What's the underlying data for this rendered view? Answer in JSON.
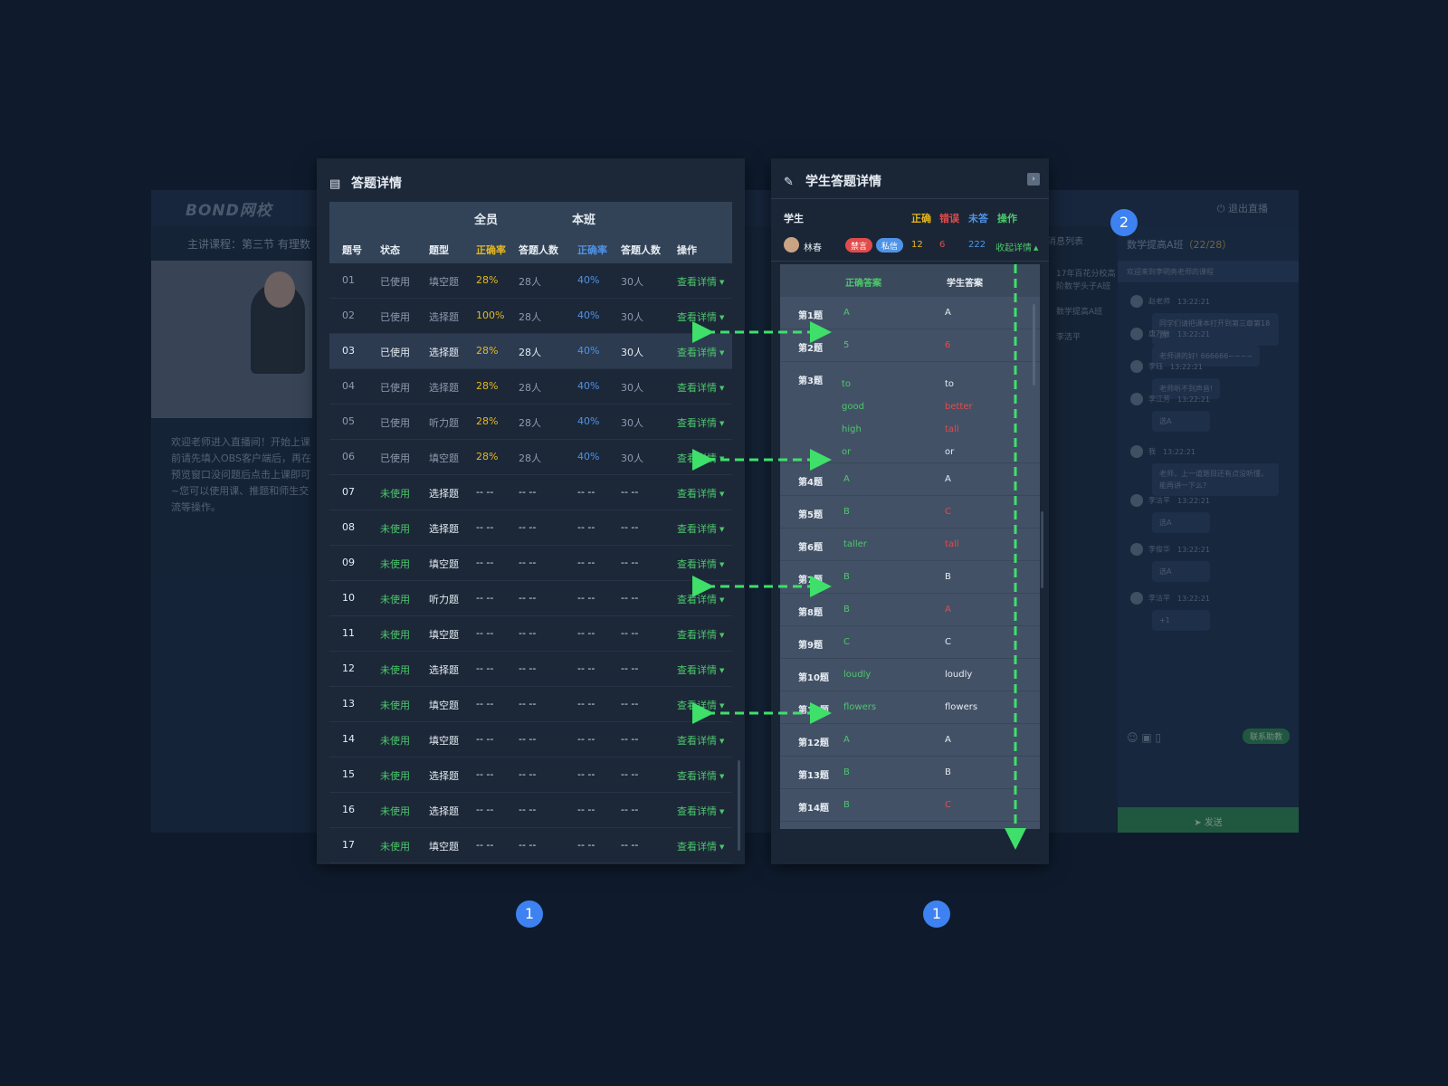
{
  "background": {
    "logo": "BOND网校",
    "exit_label": "退出直播",
    "course_label": "主讲课程：第三节 有理数",
    "welcome_text": "欢迎老师进入直播间！开始上课前请先填入OBS客户端后，再在预览窗口没问题后点击上课即可~您可以使用课、推题和师生交流等操作。",
    "message_list_label": "消息列表",
    "side_items": [
      "17年百花分校高阶数学头子A班",
      "数学提高A班",
      "李洁平"
    ],
    "chat_title": "数学提高A班",
    "chat_count": "（22/28）",
    "chat_welcome": "欢迎来到李明亮老师的课程",
    "chat_messages": [
      {
        "name": "赵老师",
        "time": "13:22:21",
        "text": "同学们请把课本打开到第三章第18页!"
      },
      {
        "name": "唐万敏",
        "time": "13:22:21",
        "text": "老师讲的好! 666666~~~~"
      },
      {
        "name": "李钰",
        "time": "13:22:21",
        "text": "老师听不到声音!"
      },
      {
        "name": "李江芳",
        "time": "13:22:21",
        "text": "选A"
      },
      {
        "name": "我",
        "time": "13:22:21",
        "text": "老师，上一道题目还有点没听懂，能再讲一下么?"
      },
      {
        "name": "李洁平",
        "time": "13:22:21",
        "text": "选A"
      },
      {
        "name": "李俊华",
        "time": "13:22:21",
        "text": "选A"
      },
      {
        "name": "李洁平",
        "time": "13:22:21",
        "text": "+1"
      }
    ],
    "chat_send": "发送",
    "chat_mode": "联系助教"
  },
  "left_panel": {
    "title": "答题详情",
    "group_all": "全员",
    "group_class": "本班",
    "headers": [
      "题号",
      "状态",
      "题型",
      "正确率",
      "答题人数",
      "正确率",
      "答题人数",
      "操作"
    ],
    "op_label": "查看详情",
    "rows": [
      {
        "no": "01",
        "status": "已使用",
        "type": "填空题",
        "rate_all": "28%",
        "count_all": "28人",
        "rate_class": "40%",
        "count_class": "30人",
        "used": true
      },
      {
        "no": "02",
        "status": "已使用",
        "type": "选择题",
        "rate_all": "100%",
        "count_all": "28人",
        "rate_class": "40%",
        "count_class": "30人",
        "used": true
      },
      {
        "no": "03",
        "status": "已使用",
        "type": "选择题",
        "rate_all": "28%",
        "count_all": "28人",
        "rate_class": "40%",
        "count_class": "30人",
        "used": true,
        "selected": true
      },
      {
        "no": "04",
        "status": "已使用",
        "type": "选择题",
        "rate_all": "28%",
        "count_all": "28人",
        "rate_class": "40%",
        "count_class": "30人",
        "used": true
      },
      {
        "no": "05",
        "status": "已使用",
        "type": "听力题",
        "rate_all": "28%",
        "count_all": "28人",
        "rate_class": "40%",
        "count_class": "30人",
        "used": true
      },
      {
        "no": "06",
        "status": "已使用",
        "type": "填空题",
        "rate_all": "28%",
        "count_all": "28人",
        "rate_class": "40%",
        "count_class": "30人",
        "used": true
      },
      {
        "no": "07",
        "status": "未使用",
        "type": "选择题",
        "rate_all": "-- --",
        "count_all": "-- --",
        "rate_class": "-- --",
        "count_class": "-- --",
        "used": false
      },
      {
        "no": "08",
        "status": "未使用",
        "type": "选择题",
        "rate_all": "-- --",
        "count_all": "-- --",
        "rate_class": "-- --",
        "count_class": "-- --",
        "used": false
      },
      {
        "no": "09",
        "status": "未使用",
        "type": "填空题",
        "rate_all": "-- --",
        "count_all": "-- --",
        "rate_class": "-- --",
        "count_class": "-- --",
        "used": false
      },
      {
        "no": "10",
        "status": "未使用",
        "type": "听力题",
        "rate_all": "-- --",
        "count_all": "-- --",
        "rate_class": "-- --",
        "count_class": "-- --",
        "used": false
      },
      {
        "no": "11",
        "status": "未使用",
        "type": "填空题",
        "rate_all": "-- --",
        "count_all": "-- --",
        "rate_class": "-- --",
        "count_class": "-- --",
        "used": false
      },
      {
        "no": "12",
        "status": "未使用",
        "type": "选择题",
        "rate_all": "-- --",
        "count_all": "-- --",
        "rate_class": "-- --",
        "count_class": "-- --",
        "used": false
      },
      {
        "no": "13",
        "status": "未使用",
        "type": "填空题",
        "rate_all": "-- --",
        "count_all": "-- --",
        "rate_class": "-- --",
        "count_class": "-- --",
        "used": false
      },
      {
        "no": "14",
        "status": "未使用",
        "type": "填空题",
        "rate_all": "-- --",
        "count_all": "-- --",
        "rate_class": "-- --",
        "count_class": "-- --",
        "used": false
      },
      {
        "no": "15",
        "status": "未使用",
        "type": "选择题",
        "rate_all": "-- --",
        "count_all": "-- --",
        "rate_class": "-- --",
        "count_class": "-- --",
        "used": false
      },
      {
        "no": "16",
        "status": "未使用",
        "type": "选择题",
        "rate_all": "-- --",
        "count_all": "-- --",
        "rate_class": "-- --",
        "count_class": "-- --",
        "used": false
      },
      {
        "no": "17",
        "status": "未使用",
        "type": "填空题",
        "rate_all": "-- --",
        "count_all": "-- --",
        "rate_class": "-- --",
        "count_class": "-- --",
        "used": false
      }
    ]
  },
  "right_panel": {
    "title": "学生答题详情",
    "student_label": "学生",
    "legend": [
      "正确",
      "错误",
      "未答",
      "操作"
    ],
    "student": {
      "name": "林春",
      "tag_mute": "禁言",
      "tag_private": "私信",
      "correct": "12",
      "wrong": "6",
      "unanswered": "222",
      "collapse_label": "收起详情"
    },
    "detail_headers": [
      "正确答案",
      "学生答案"
    ],
    "answers": [
      {
        "q": "第1题",
        "correct": "A",
        "student": "A",
        "wrong": false
      },
      {
        "q": "第2题",
        "correct": "5",
        "student": "6",
        "wrong": true
      },
      {
        "q": "第3题",
        "multi": true,
        "correct_lines": [
          "to",
          "good",
          "high",
          "or"
        ],
        "student_lines": [
          "to",
          "better",
          "tall",
          "or"
        ],
        "wrong_lines": [
          false,
          true,
          true,
          false
        ]
      },
      {
        "q": "第4题",
        "correct": "A",
        "student": "A",
        "wrong": false
      },
      {
        "q": "第5题",
        "correct": "B",
        "student": "C",
        "wrong": true
      },
      {
        "q": "第6题",
        "correct": "taller",
        "student": "tall",
        "wrong": true
      },
      {
        "q": "第7题",
        "correct": "B",
        "student": "B",
        "wrong": false
      },
      {
        "q": "第8题",
        "correct": "B",
        "student": "A",
        "wrong": true
      },
      {
        "q": "第9题",
        "correct": "C",
        "student": "C",
        "wrong": false
      },
      {
        "q": "第10题",
        "correct": "loudly",
        "student": "loudly",
        "wrong": false
      },
      {
        "q": "第11题",
        "correct": "flowers",
        "student": "flowers",
        "wrong": false
      },
      {
        "q": "第12题",
        "correct": "A",
        "student": "A",
        "wrong": false
      },
      {
        "q": "第13题",
        "correct": "B",
        "student": "B",
        "wrong": false
      },
      {
        "q": "第14题",
        "correct": "B",
        "student": "C",
        "wrong": true
      }
    ]
  },
  "annotations": {
    "badge_1": "1",
    "badge_2": "2"
  },
  "colors": {
    "page_bg": "#0f1b2d",
    "accent_green": "#4cc86b",
    "accent_yellow": "#e6b81d",
    "accent_red": "#e24b4b",
    "accent_blue": "#4f93e8",
    "badge_blue": "#3d82f0"
  }
}
